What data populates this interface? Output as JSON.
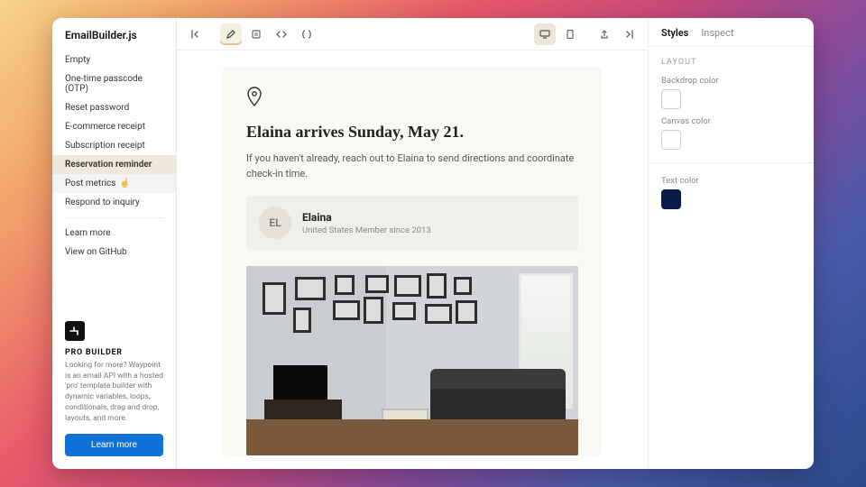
{
  "brand": "EmailBuilder.js",
  "templates": [
    {
      "label": "Empty"
    },
    {
      "label": "One-time passcode (OTP)"
    },
    {
      "label": "Reset password"
    },
    {
      "label": "E-commerce receipt"
    },
    {
      "label": "Subscription receipt"
    },
    {
      "label": "Reservation reminder",
      "active": true
    },
    {
      "label": "Post metrics",
      "hover": true
    },
    {
      "label": "Respond to inquiry"
    }
  ],
  "sidebar_links": [
    {
      "label": "Learn more"
    },
    {
      "label": "View on GitHub"
    }
  ],
  "pro": {
    "title": "PRO BUILDER",
    "copy": "Looking for more? Waypoint is an email API with a hosted 'pro' template builder with dynamic variables, loops, conditionals, drag and drop, layouts, and more.",
    "cta": "Learn more"
  },
  "toolbar": {
    "left_icons": [
      "collapse-panel-icon"
    ],
    "modes": [
      "edit-icon",
      "preview-icon",
      "html-code-icon",
      "json-code-icon"
    ],
    "active_mode": 0,
    "devices": [
      "desktop-icon",
      "mobile-icon"
    ],
    "active_device": 0,
    "right_icons": [
      "share-icon",
      "expand-panel-icon"
    ]
  },
  "email": {
    "headline": "Elaina arrives Sunday, May 21.",
    "body": "If you haven't already, reach out to Elaina to send directions and coordinate check-in time.",
    "guest": {
      "initials": "EL",
      "name": "Elaina",
      "meta": "United States Member since 2013"
    }
  },
  "inspector": {
    "tabs": [
      "Styles",
      "Inspect"
    ],
    "active_tab": 0,
    "section": "LAYOUT",
    "fields": {
      "backdrop": {
        "label": "Backdrop color",
        "value": "#ffffff"
      },
      "canvas": {
        "label": "Canvas color",
        "value": "#ffffff"
      },
      "text": {
        "label": "Text color",
        "value": "#0a1a4a"
      }
    }
  }
}
